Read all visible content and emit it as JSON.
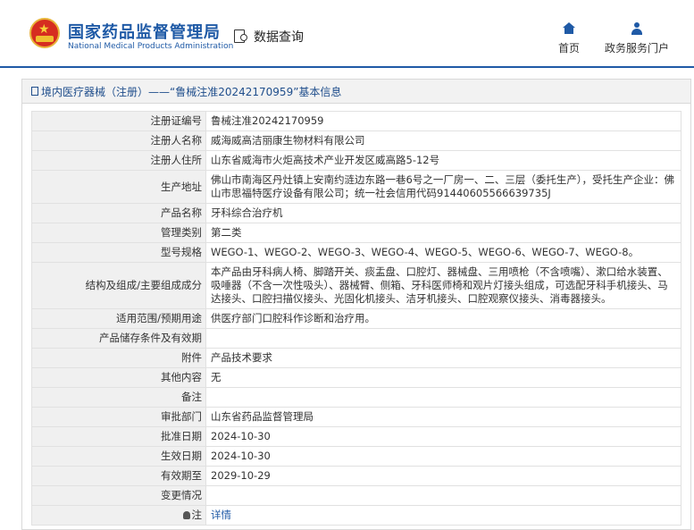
{
  "header": {
    "brand_cn": "国家药品监督管理局",
    "brand_en": "National Medical Products Administration",
    "search_label": "数据查询",
    "nav_home": "首页",
    "nav_portal": "政务服务门户"
  },
  "breadcrumb": "境内医疗器械（注册）——“鲁械注准20242170959”基本信息",
  "rows": [
    {
      "label": "注册证编号",
      "value": "鲁械注准20242170959"
    },
    {
      "label": "注册人名称",
      "value": "威海威高洁丽康生物材料有限公司"
    },
    {
      "label": "注册人住所",
      "value": "山东省威海市火炬高技术产业开发区威高路5-12号"
    },
    {
      "label": "生产地址",
      "value": "佛山市南海区丹灶镇上安南约涟边东路一巷6号之一厂房一、二、三层（委托生产），受托生产企业：佛山市思福特医疗设备有限公司；统一社会信用代码91440605566639735J"
    },
    {
      "label": "产品名称",
      "value": "牙科综合治疗机"
    },
    {
      "label": "管理类别",
      "value": "第二类"
    },
    {
      "label": "型号规格",
      "value": "WEGO-1、WEGO-2、WEGO-3、WEGO-4、WEGO-5、WEGO-6、WEGO-7、WEGO-8。"
    },
    {
      "label": "结构及组成/主要组成成分",
      "value": "本产品由牙科病人椅、脚踏开关、痰盂盘、口腔灯、器械盘、三用喷枪（不含喷嘴）、漱口给水装置、吸唾器（不含一次性吸头）、器械臂、侧箱、牙科医师椅和观片灯接头组成，可选配牙科手机接头、马达接头、口腔扫描仪接头、光固化机接头、洁牙机接头、口腔观察仪接头、消毒器接头。"
    },
    {
      "label": "适用范围/预期用途",
      "value": "供医疗部门口腔科作诊断和治疗用。"
    },
    {
      "label": "产品储存条件及有效期",
      "value": ""
    },
    {
      "label": "附件",
      "value": "产品技术要求"
    },
    {
      "label": "其他内容",
      "value": "无"
    },
    {
      "label": "备注",
      "value": ""
    },
    {
      "label": "审批部门",
      "value": "山东省药品监督管理局"
    },
    {
      "label": "批准日期",
      "value": "2024-10-30"
    },
    {
      "label": "生效日期",
      "value": "2024-10-30"
    },
    {
      "label": "有效期至",
      "value": "2029-10-29"
    },
    {
      "label": "变更情况",
      "value": ""
    }
  ],
  "note": {
    "label": "注",
    "link": "详情"
  }
}
